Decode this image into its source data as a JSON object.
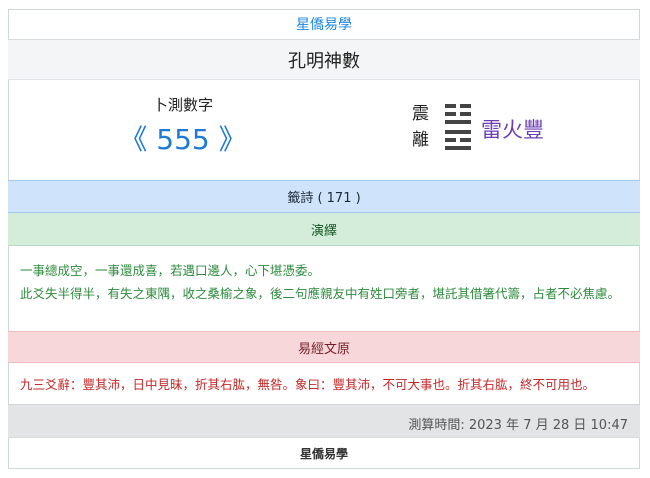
{
  "header": {
    "site_title": "星僑易學"
  },
  "title": "孔明神數",
  "query": {
    "label": "卜測數字",
    "number": "《 555 》"
  },
  "hexagram": {
    "upper_trigram": "震",
    "lower_trigram": "離",
    "name": "雷火豐",
    "symbol_icon": "hexagram-symbol-icon"
  },
  "sections": {
    "poem_label": "籤詩 ( 171 )",
    "interpretation_label": "演繹",
    "classic_label": "易經文原"
  },
  "interpretation": {
    "line1": "一事總成空，一事還成喜，若遇口邊人，心下堪憑委。",
    "line2": "此爻失半得半，有失之東隅，收之桑榆之象，後二句應親友中有姓口旁者，堪託其借箸代籌，占者不必焦慮。"
  },
  "classic_text": "九三爻辭：豐其沛，日中見昧，折其右肱，無咎。象曰：豐其沛，不可大事也。折其右肱，終不可用也。",
  "timestamp": "測算時間: 2023 年 7 月 28 日 10:47",
  "footer": {
    "site_name": "星僑易學"
  },
  "colors": {
    "accent_blue": "#1e7ad8",
    "hexagram_purple": "#6a3fb5",
    "interpretation_green": "#2e8b3e",
    "classic_red": "#c62828"
  }
}
